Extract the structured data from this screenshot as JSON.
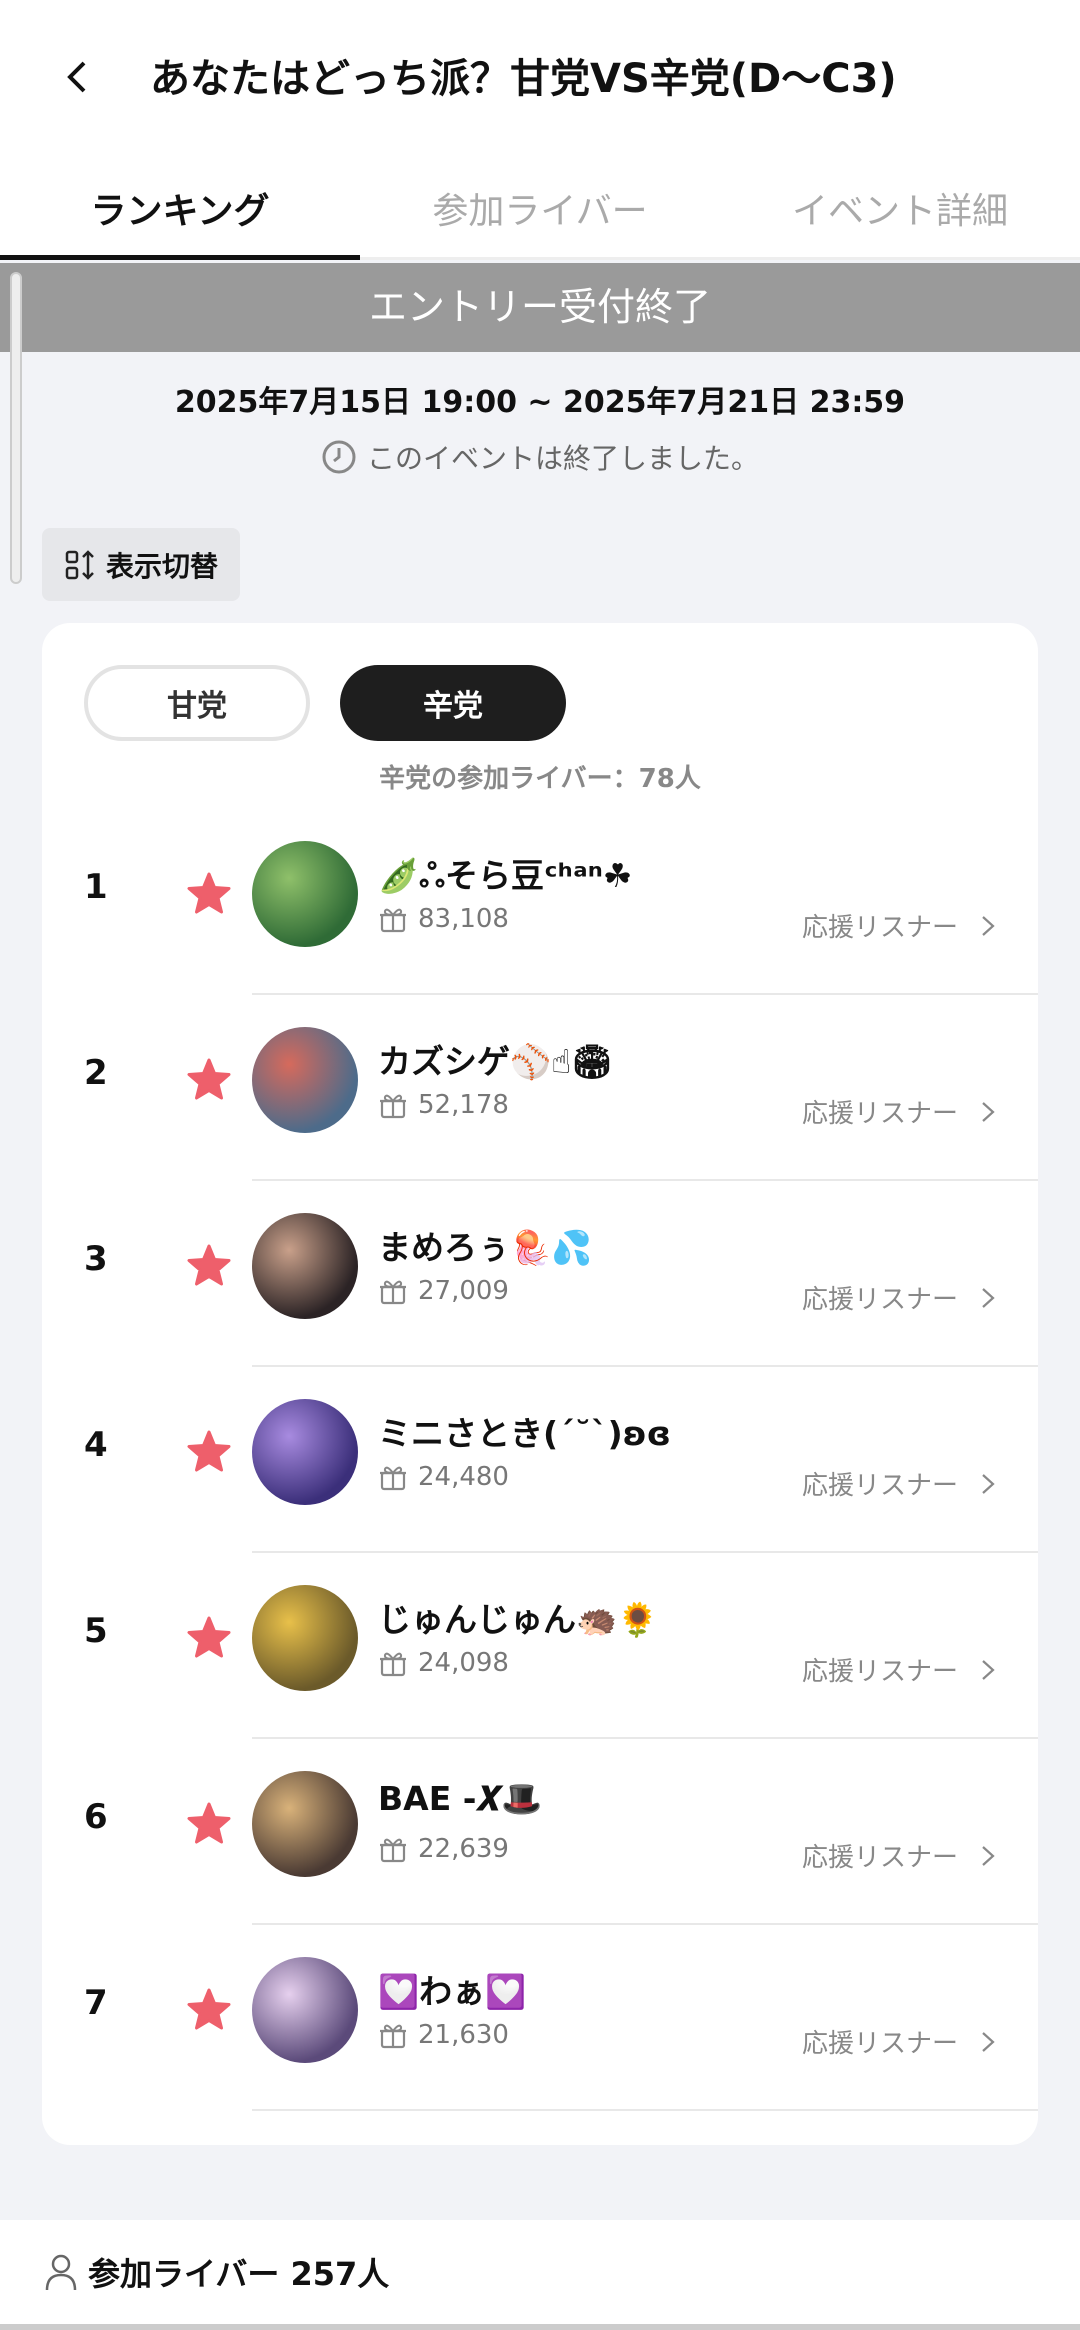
{
  "header": {
    "title": "あなたはどっち派？甘党VS辛党(D〜C3)"
  },
  "tabs": [
    {
      "label": "ランキング",
      "active": true
    },
    {
      "label": "参加ライバー",
      "active": false
    },
    {
      "label": "イベント詳細",
      "active": false
    }
  ],
  "banner": "エントリー受付終了",
  "period": "2025年7月15日 19:00 ~ 2025年7月21日 23:59",
  "ended_text": "このイベントは終了しました。",
  "toggle_label": "表示切替",
  "segments": {
    "sweet": "甘党",
    "spicy": "辛党",
    "selected": "辛党"
  },
  "participant_count_text": "辛党の参加ライバー：78人",
  "rows": [
    {
      "rank": "1",
      "name": "🫛ஃそら豆ᶜʰᵃⁿ☘",
      "points": "83,108",
      "support": "応援リスナー",
      "avatar_colors": [
        "#2f6b36",
        "#8fc06a"
      ]
    },
    {
      "rank": "2",
      "name": "カズシゲ⚾☝🏟",
      "points": "52,178",
      "support": "応援リスナー",
      "avatar_colors": [
        "#4d6b8a",
        "#d66a5c"
      ]
    },
    {
      "rank": "3",
      "name": "まめろぅ🪼💦",
      "points": "27,009",
      "support": "応援リスナー",
      "avatar_colors": [
        "#2b2325",
        "#c9a08a"
      ]
    },
    {
      "rank": "4",
      "name": "ミニさとき(ˊ˘ˋ)ʚɞ",
      "points": "24,480",
      "support": "応援リスナー",
      "avatar_colors": [
        "#3b2f7a",
        "#a88be0"
      ]
    },
    {
      "rank": "5",
      "name": "じゅんじゅん🦔🌻",
      "points": "24,098",
      "support": "応援リスナー",
      "avatar_colors": [
        "#6b5a2a",
        "#e8c04a"
      ]
    },
    {
      "rank": "6",
      "name": "BAE -𝑿🎩",
      "points": "22,639",
      "support": "応援リスナー",
      "avatar_colors": [
        "#4a3a33",
        "#d9b27a"
      ]
    },
    {
      "rank": "7",
      "name": "💟わぁ💟",
      "points": "21,630",
      "support": "応援リスナー",
      "avatar_colors": [
        "#5b4a7a",
        "#e6d0ee"
      ]
    }
  ],
  "footer": {
    "label": "参加ライバー 257人"
  },
  "colors": {
    "star": "#ee5f6b",
    "banner": "#9a9a9a"
  }
}
